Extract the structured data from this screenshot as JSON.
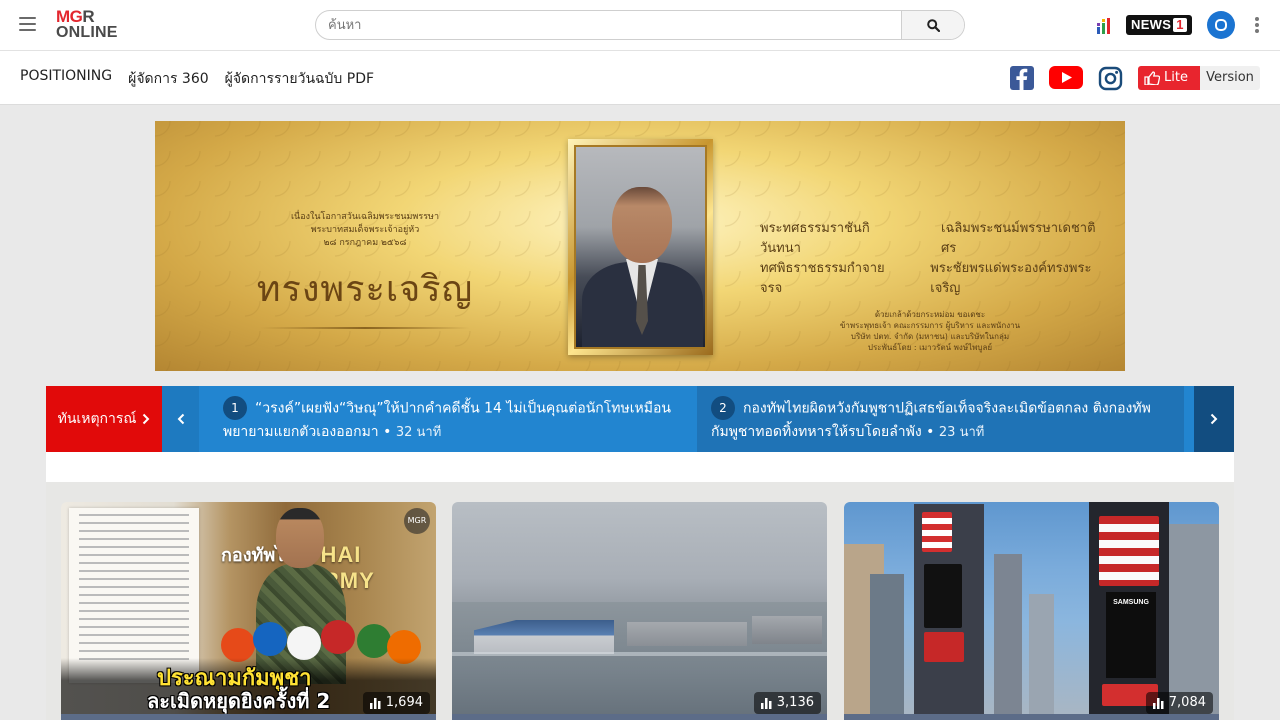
{
  "header": {
    "logo_line1_red": "MG",
    "logo_line1_grey": "R",
    "logo_line2": "ONLINE",
    "search": {
      "placeholder": "ค้นหา",
      "value": ""
    },
    "news1": {
      "text": "NEWS",
      "number": "1"
    }
  },
  "nav": {
    "links": [
      "POSITIONING",
      "ผู้จัดการ 360",
      "ผู้จัดการรายวันฉบับ PDF"
    ],
    "lite": {
      "label": "Lite",
      "version": "Version"
    }
  },
  "banner": {
    "left_small_1": "เนื่องในโอกาสวันเฉลิมพระชนมพรรษา",
    "left_small_2": "พระบาทสมเด็จพระเจ้าอยู่หัว",
    "left_small_3": "๒๘ กรกฎาคม ๒๕๖๘",
    "headline": "ทรงพระเจริญ",
    "right_row1_a": "พระทศธรรมราชันกิวันทนา",
    "right_row1_b": "เฉลิมพระชนม์พรรษาเดชาติศร",
    "right_row2_a": "ทศพิธราชธรรมกำจายจรจ",
    "right_row2_b": "พระชัยพรแด่พระองค์ทรงพระเจริญ",
    "right_small_1": "ด้วยเกล้าด้วยกระหม่อม ขอเดชะ",
    "right_small_2": "ข้าพระพุทธเจ้า คณะกรรมการ ผู้บริหาร และพนักงาน",
    "right_small_3": "บริษัท ปตท. จำกัด (มหาชน) และบริษัทในกลุ่ม",
    "right_small_4": "ประพันธ์โดย : เมาวรัตน์ พงษ์ไพบูลย์"
  },
  "ticker": {
    "label": "ทันเหตุการณ์",
    "items": [
      {
        "num": "1",
        "title": "“วรงค์”เผยฟัง“วิษณุ”ให้ปากคำคดีชั้น 14 ไม่เป็นคุณต่อนักโทษเหมือนพยายามแยกตัวเองออกมา",
        "time": "32 นาที"
      },
      {
        "num": "2",
        "title": "กองทัพไทยผิดหวังกัมพูชาปฏิเสธข้อเท็จจริงละเมิดข้อตกลง ติงกองทัพกัมพูชาทอดทิ้งทหารให้รบโดยลำพัง",
        "time": "23 นาที"
      }
    ]
  },
  "cards": [
    {
      "views": "1,694",
      "caption_1": "ประณามกัมพูชา",
      "caption_2": "ละเมิดหยุดยิงครั้งที่ 2",
      "overlay_th": "กองทัพไทย",
      "overlay_en": "THAI ARMY",
      "badge": "MGR"
    },
    {
      "views": "3,136"
    },
    {
      "views": "7,084",
      "billboard": "SAMSUNG"
    }
  ],
  "colors": {
    "brand_red": "#e3262e",
    "ticker_blue": "#2285d0",
    "ticker_red": "#e10a0a",
    "profile_blue": "#1b74d1"
  },
  "icons": [
    "menu-icon",
    "search-icon",
    "podcast-bars-icon",
    "profile-icon",
    "more-vertical-icon",
    "facebook-icon",
    "youtube-icon",
    "instagram-icon",
    "thumbs-up-icon",
    "chevron-right-icon",
    "chevron-left-icon",
    "bar-chart-icon"
  ]
}
